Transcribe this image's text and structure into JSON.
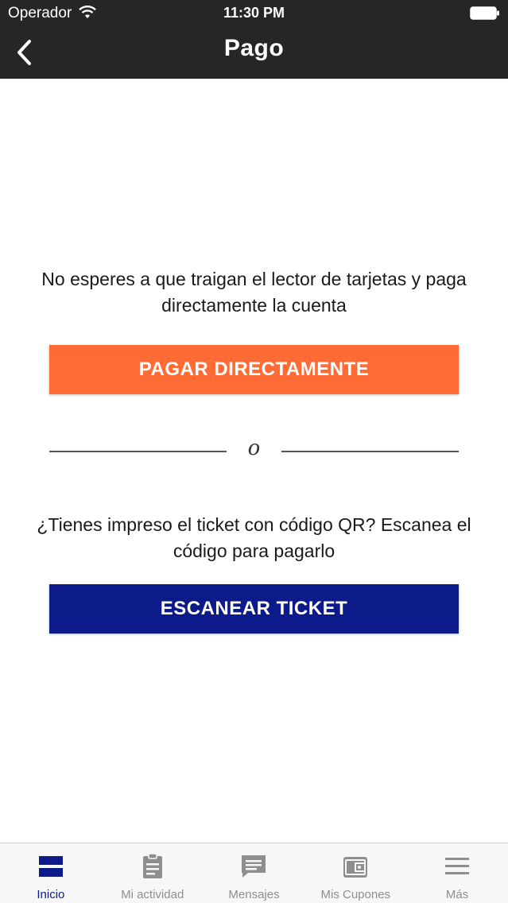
{
  "status_bar": {
    "carrier": "Operador",
    "time": "11:30 PM"
  },
  "nav": {
    "title": "Pago"
  },
  "main": {
    "pay_prompt": "No esperes a que traigan el lector de tarjetas y paga directamente la cuenta",
    "pay_button_label": "PAGAR DIRECTAMENTE",
    "divider_text": "o",
    "scan_prompt": "¿Tienes impreso el ticket con código QR? Escanea el código para pagarlo",
    "scan_button_label": "ESCANEAR TICKET"
  },
  "tab_bar": {
    "tabs": [
      {
        "label": "Inicio",
        "icon": "home-icon",
        "active": true
      },
      {
        "label": "Mi actividad",
        "icon": "clipboard-icon",
        "active": false
      },
      {
        "label": "Mensajes",
        "icon": "message-icon",
        "active": false
      },
      {
        "label": "Mis Cupones",
        "icon": "wallet-icon",
        "active": false
      },
      {
        "label": "Más",
        "icon": "menu-icon",
        "active": false
      }
    ]
  },
  "colors": {
    "header_bg": "#262626",
    "pay_button": "#fe6b35",
    "scan_button": "#0c1a8a",
    "tab_active": "#0c1a8a",
    "tab_inactive": "#8e8e8e"
  }
}
